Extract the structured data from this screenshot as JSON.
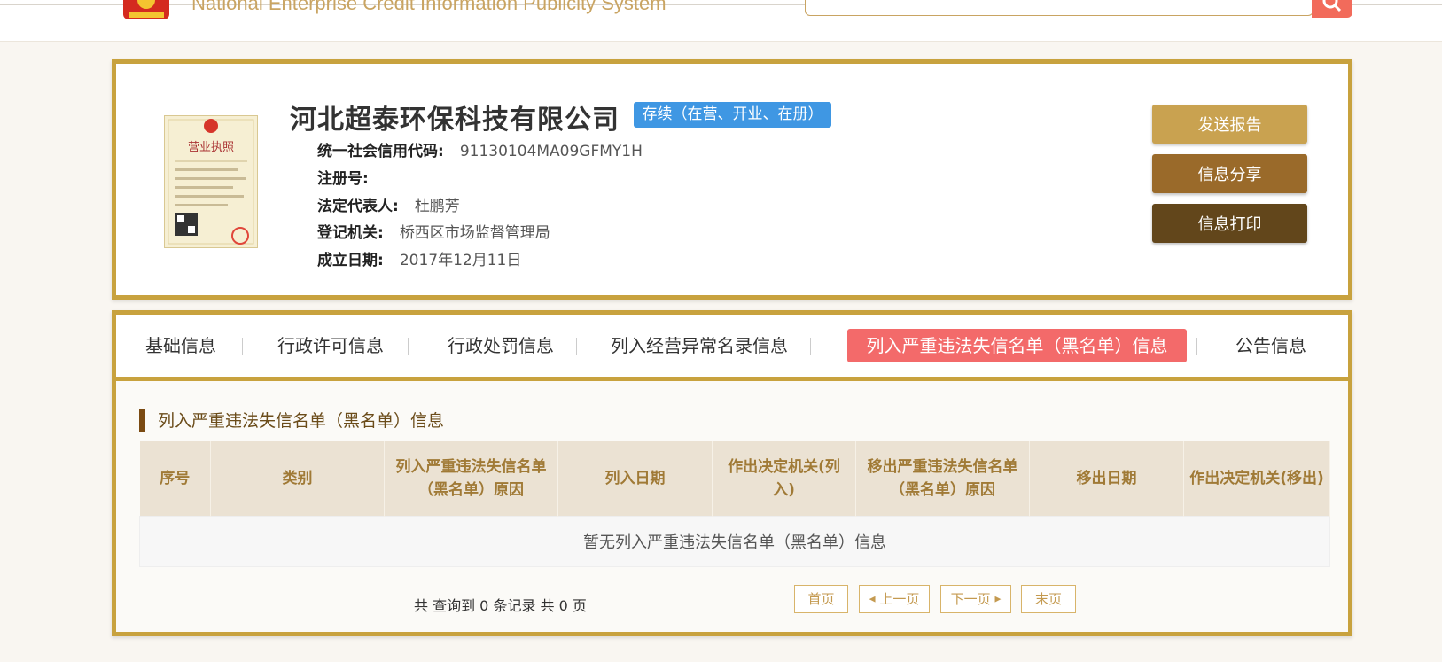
{
  "header": {
    "system_title": "National Enterprise Credit Information Publicity System",
    "search_value": ""
  },
  "company": {
    "name": "河北超泰环保科技有限公司",
    "status": "存续（在营、开业、在册）",
    "fields": [
      {
        "label": "统一社会信用代码:",
        "value": "91130104MA09GFMY1H"
      },
      {
        "label": "注册号:",
        "value": ""
      },
      {
        "label": "法定代表人:",
        "value": "杜鹏芳"
      },
      {
        "label": "登记机关:",
        "value": "桥西区市场监督管理局"
      },
      {
        "label": "成立日期:",
        "value": "2017年12月11日"
      }
    ],
    "license_title": "营业执照"
  },
  "actions": {
    "send_report": "发送报告",
    "share": "信息分享",
    "print": "信息打印"
  },
  "tabs": [
    {
      "label": "基础信息",
      "active": false
    },
    {
      "label": "行政许可信息",
      "active": false
    },
    {
      "label": "行政处罚信息",
      "active": false
    },
    {
      "label": "列入经营异常名录信息",
      "active": false
    },
    {
      "label": "列入严重违法失信名单（黑名单）信息",
      "active": true
    },
    {
      "label": "公告信息",
      "active": false
    }
  ],
  "section": {
    "title": "列入严重违法失信名单（黑名单）信息",
    "columns": [
      "序号",
      "类别",
      "列入严重违法失信名单（黑名单）原因",
      "列入日期",
      "作出决定机关(列入)",
      "移出严重违法失信名单（黑名单）原因",
      "移出日期",
      "作出决定机关(移出)"
    ],
    "empty_message": "暂无列入严重违法失信名单（黑名单）信息"
  },
  "pagination": {
    "summary": "共 查询到 0 条记录 共 0 页",
    "first": "首页",
    "prev": "上一页",
    "next": "下一页",
    "last": "末页"
  },
  "colors": {
    "gold_border": "#c8a23e",
    "status_blue": "#3f97e3",
    "active_tab": "#f36a6a",
    "btn_report": "#c9a250",
    "btn_share": "#9a6a2a",
    "btn_print": "#62461b"
  }
}
